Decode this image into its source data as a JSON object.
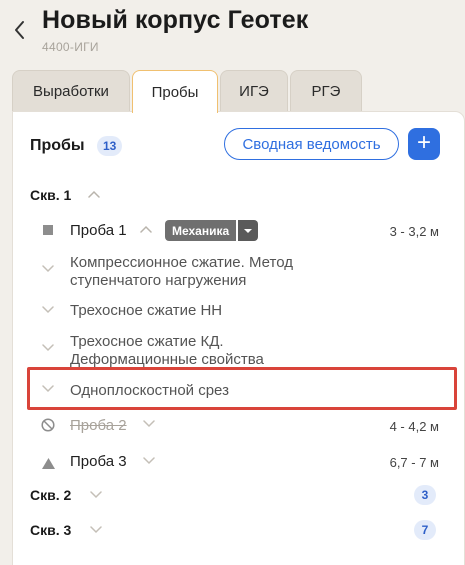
{
  "header": {
    "title": "Новый корпус Геотек",
    "subtitle": "4400-ИГИ"
  },
  "tabs": [
    {
      "label": "Выработки",
      "active": false
    },
    {
      "label": "Пробы",
      "active": true
    },
    {
      "label": "ИГЭ",
      "active": false
    },
    {
      "label": "РГЭ",
      "active": false
    }
  ],
  "section": {
    "title": "Пробы",
    "count": "13",
    "summary_button": "Сводная ведомость",
    "add_button": "+"
  },
  "wells": [
    {
      "label": "Скв. 1",
      "expanded": true,
      "samples": [
        {
          "label": "Проба 1",
          "marker": "square-icon",
          "tag": "Механика",
          "range": "3 - 3,2 м",
          "tests": [
            {
              "label": "Компрессионное сжатие. Метод ступенчатого нагружения",
              "lines": [
                "Компрессионное сжатие. Метод",
                "ступенчатого нагружения"
              ]
            },
            {
              "label": "Трехосное сжатие НН"
            },
            {
              "label": "Трехосное сжатие КД. Деформационные свойства",
              "lines": [
                "Трехосное сжатие КД.",
                "Деформационные свойства"
              ]
            },
            {
              "label": "Одноплоскостной срез",
              "highlighted": true
            }
          ]
        },
        {
          "label": "Проба 2",
          "marker": "ban-icon",
          "struck": true,
          "range": "4 - 4,2 м"
        },
        {
          "label": "Проба 3",
          "marker": "triangle-icon",
          "range": "6,7 - 7 м"
        }
      ]
    },
    {
      "label": "Скв. 2",
      "count": "3",
      "expanded": false
    },
    {
      "label": "Скв. 3",
      "count": "7",
      "expanded": false
    }
  ],
  "colors": {
    "accent": "#2f6fe0",
    "highlight": "#d9443a",
    "tab_active_border": "#f0c070",
    "badge_bg": "#e3ebfa"
  }
}
